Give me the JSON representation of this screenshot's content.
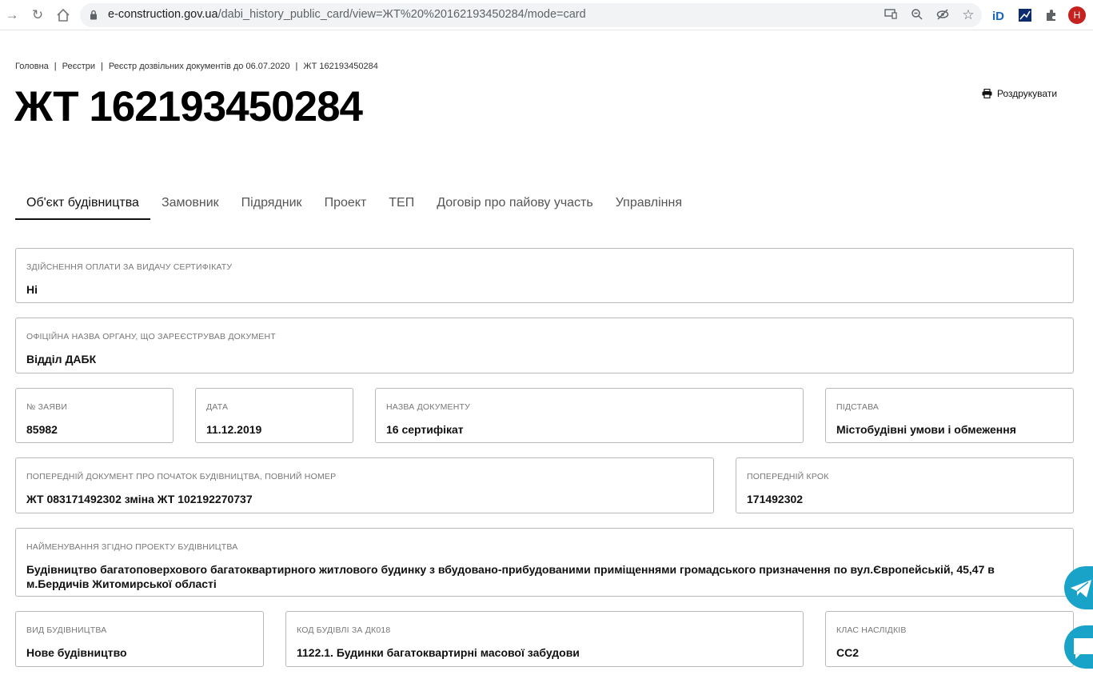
{
  "browser": {
    "url_host": "e-construction.gov.ua",
    "url_path": "/dabi_history_public_card/view=ЖТ%20%20162193450284/mode=card",
    "avatar_letter": "H"
  },
  "breadcrumb": [
    "Головна",
    "Реєстри",
    "Реєстр дозвільних документів до 06.07.2020",
    "ЖТ 162193450284"
  ],
  "title": "ЖТ 162193450284",
  "print_label": "Роздрукувати",
  "tabs": [
    "Об'єкт будівництва",
    "Замовник",
    "Підрядник",
    "Проект",
    "ТЕП",
    "Договір про пайову участь",
    "Управління"
  ],
  "fields": {
    "payment": {
      "label": "Здійснення оплати за видачу сертифікату",
      "value": "Ні"
    },
    "authority": {
      "label": "Офіційна назва органу, що зареєстрував документ",
      "value": "Відділ ДАБК"
    },
    "application_no": {
      "label": "№ заяви",
      "value": "85982"
    },
    "date": {
      "label": "Дата",
      "value": "11.12.2019"
    },
    "doc_name": {
      "label": "Назва документу",
      "value": "16 сертифікат"
    },
    "basis": {
      "label": "Підстава",
      "value": "Містобудівні умови і обмеження"
    },
    "prev_doc": {
      "label": "Попередній документ про початок будівництва, повний номер",
      "value": "ЖТ 083171492302 зміна ЖТ 102192270737"
    },
    "prev_step": {
      "label": "Попередній крок",
      "value": "171492302"
    },
    "project_name": {
      "label": "Найменування згідно проекту будівництва",
      "value": "Будівництво багатоповерхового багатоквартирного житлового будинку з вбудовано-прибудованими приміщеннями громадського призначення по вул.Європейській, 45,47 в м.Бердичів Житомирської області"
    },
    "construction_type": {
      "label": "Вид будівництва",
      "value": "Нове будівництво"
    },
    "building_code": {
      "label": "Код будівлі за ДК018",
      "value": "1122.1. Будинки багатоквартирні масової забудови"
    },
    "consequence_class": {
      "label": "Клас наслідків",
      "value": "СС2"
    }
  },
  "colors": {
    "accent": "#1aa3c8",
    "border": "#b9b9b9"
  }
}
